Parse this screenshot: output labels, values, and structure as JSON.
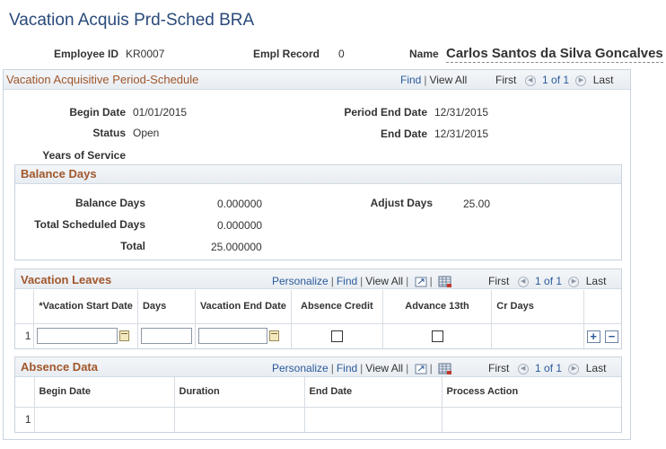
{
  "page": {
    "title": "Vacation Acquis Prd-Sched BRA"
  },
  "employee": {
    "id_label": "Employee ID",
    "id_value": "KR0007",
    "record_label": "Empl Record",
    "record_value": "0",
    "name_label": "Name",
    "name_value": "Carlos Santos da Silva Goncalves"
  },
  "period_section": {
    "title": "Vacation Acquisitive Period-Schedule",
    "find": "Find",
    "view_all": "View All",
    "first": "First",
    "counter": "1 of 1",
    "last": "Last",
    "begin_date_label": "Begin Date",
    "begin_date": "01/01/2015",
    "period_end_date_label": "Period End Date",
    "period_end_date": "12/31/2015",
    "status_label": "Status",
    "status": "Open",
    "end_date_label": "End Date",
    "end_date": "12/31/2015",
    "years_of_service_label": "Years of Service"
  },
  "balance": {
    "title": "Balance Days",
    "balance_days_label": "Balance Days",
    "balance_days": "0.000000",
    "adjust_days_label": "Adjust Days",
    "adjust_days": "25.00",
    "total_scheduled_label": "Total Scheduled Days",
    "total_scheduled": "0.000000",
    "total_label": "Total",
    "total": "25.000000"
  },
  "vacation_leaves": {
    "title": "Vacation Leaves",
    "personalize": "Personalize",
    "find": "Find",
    "view_all": "View All",
    "first": "First",
    "counter": "1 of 1",
    "last": "Last",
    "columns": [
      "*Vacation Start Date",
      "Days",
      "Vacation End Date",
      "Absence Credit",
      "Advance 13th",
      "Cr Days"
    ],
    "row_number": "1",
    "row": {
      "start_date": "",
      "days": "",
      "end_date": "",
      "absence_credit": false,
      "advance_13th": false,
      "cr_days": ""
    }
  },
  "absence_data": {
    "title": "Absence Data",
    "personalize": "Personalize",
    "find": "Find",
    "view_all": "View All",
    "first": "First",
    "counter": "1 of 1",
    "last": "Last",
    "columns": [
      "Begin Date",
      "Duration",
      "End Date",
      "Process Action"
    ],
    "row_number": "1"
  },
  "icons": {
    "add": "+",
    "remove": "−"
  }
}
